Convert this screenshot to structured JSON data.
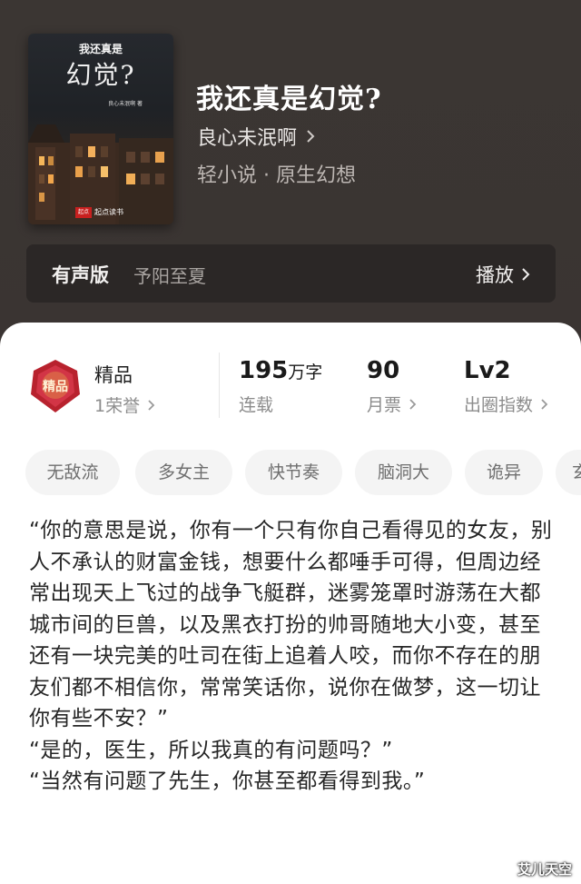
{
  "book": {
    "title": "我还真是幻觉?",
    "author": "良心未泯啊",
    "genre": "轻小说 · 原生幻想",
    "cover": {
      "title_top": "我还真是",
      "title_big": "幻觉?",
      "author": "良心未泯啊 著",
      "badge": "起点",
      "brand": "起点读书"
    }
  },
  "audio": {
    "label": "有声版",
    "narrator": "予阳至夏",
    "play_label": "播放"
  },
  "stats": {
    "quality": {
      "title": "精品",
      "sub": "1荣誉",
      "badge_text": "精品"
    },
    "words": {
      "value": "195",
      "unit": "万字",
      "label": "连载"
    },
    "tickets": {
      "value": "90",
      "label": "月票"
    },
    "level": {
      "value": "Lv2",
      "label": "出圈指数"
    }
  },
  "tags": [
    "无敌流",
    "多女主",
    "快节奏",
    "脑洞大",
    "诡异",
    "玄"
  ],
  "synopsis": [
    "“你的意思是说，你有一个只有你自己看得见的女友，别人不承认的财富金钱，想要什么都唾手可得，但周边经常出现天上飞过的战争飞艇群，迷雾笼罩时游荡在大都城市间的巨兽，以及黑衣打扮的帅哥随地大小变，甚至还有一块完美的吐司在街上追着人咬，而你不存在的朋友们都不相信你，常常笑话你，说你在做梦，这一切让你有些不安？”",
    "“是的，医生，所以我真的有问题吗？”",
    "“当然有问题了先生，你甚至都看得到我。”"
  ],
  "watermark": "艾儿天空",
  "colors": {
    "header_bg": "#3a3432",
    "sheet_bg": "#ffffff",
    "tag_bg": "#f4f4f4",
    "badge_red": "#b8222e"
  }
}
